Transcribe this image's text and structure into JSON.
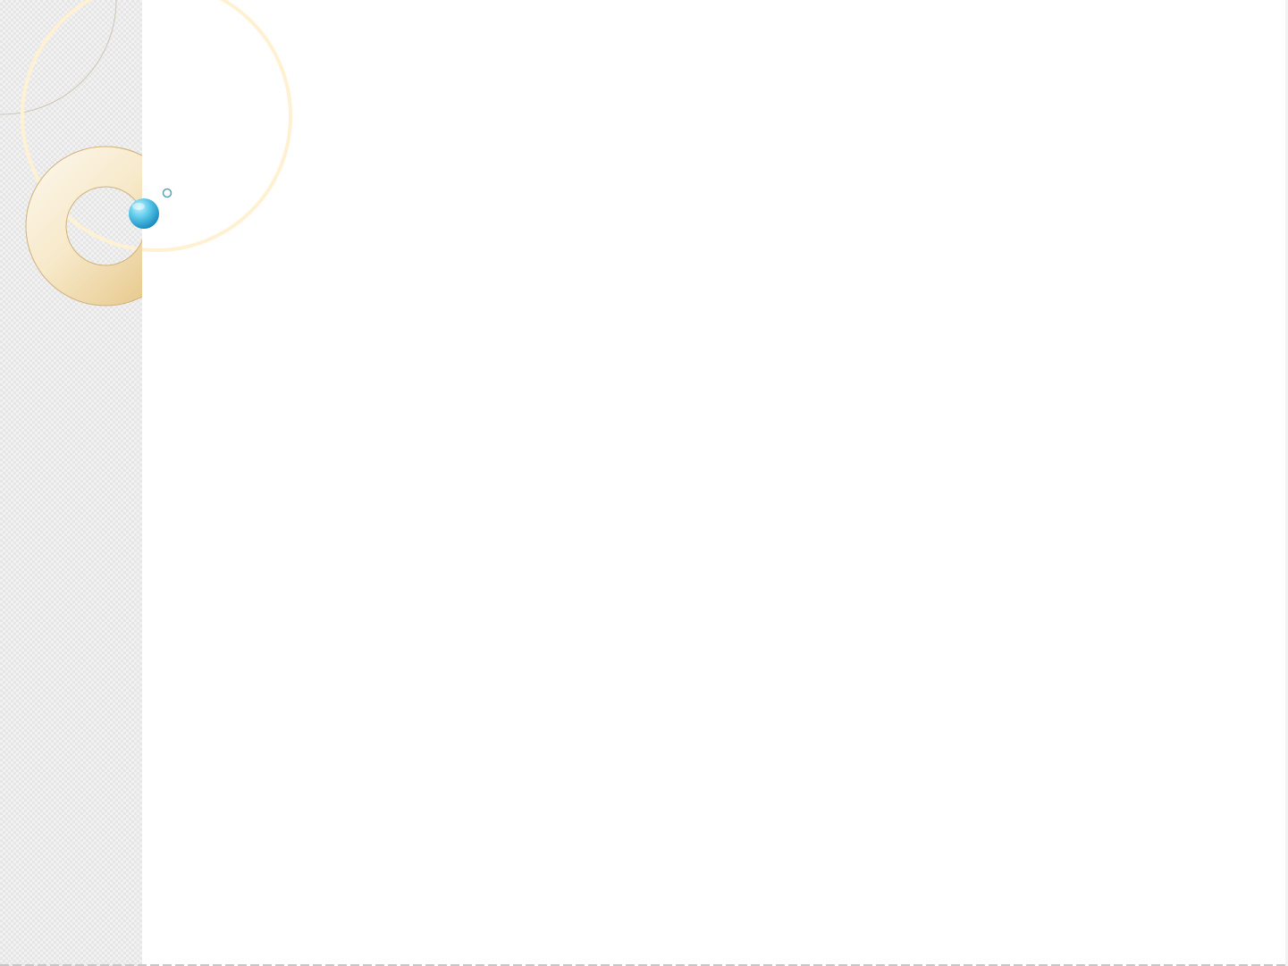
{
  "colors": {
    "background": "#ffffff",
    "strip_base": "#f1f1f1",
    "strip_check": "#e6e6e6",
    "ring_light": "#fbf4e4",
    "ring_dark": "#e8c98c",
    "ring_outline": "#d2b17a",
    "faint_arc": "#fff1d2",
    "thin_arc": "#cfc5b3",
    "sphere_light": "#b6ecfb",
    "sphere_dark": "#1593c6",
    "small_circle": "#5aa2b8"
  },
  "decorations": [
    "thin-arc",
    "faint-arc",
    "gold-ring-icon",
    "blue-sphere-icon",
    "small-circle-icon"
  ]
}
